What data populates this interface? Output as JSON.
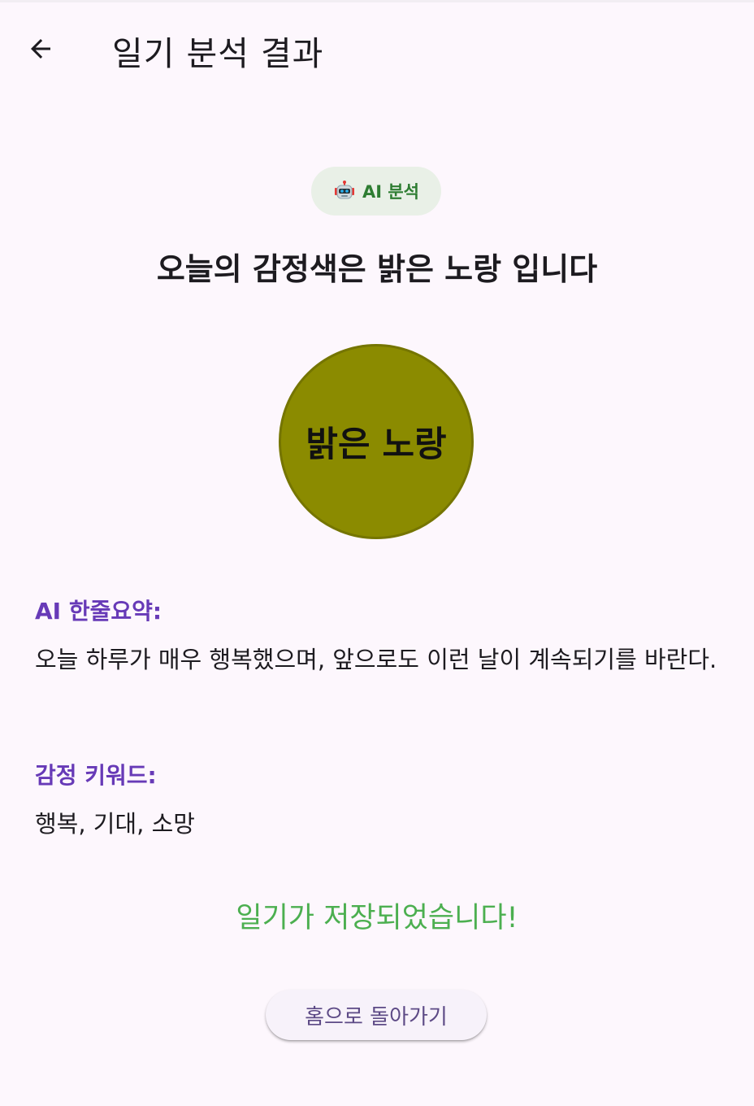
{
  "appbar": {
    "title": "일기 분석 결과",
    "back_icon": "arrow-left-icon"
  },
  "chip": {
    "icon": "robot-icon",
    "label": "AI 분석",
    "color": "#2e7d32",
    "background": "#e9f0e7"
  },
  "headline": "오늘의 감정색은 밝은 노랑 입니다",
  "emotion_color": {
    "label": "밝은 노랑",
    "fill": "#8b8b00",
    "border": "#757500"
  },
  "summary": {
    "title": "AI 한줄요약:",
    "text": "오늘 하루가 매우 행복했으며, 앞으로도 이런 날이 계속되기를 바란다."
  },
  "keywords": {
    "title": "감정 키워드:",
    "text": "행복, 기대, 소망"
  },
  "saved_message": "일기가 저장되었습니다!",
  "home_button": {
    "label": "홈으로 돌아가기"
  },
  "colors": {
    "background": "#fdf7fd",
    "accent_purple": "#673ab7",
    "success_green": "#4caf50"
  }
}
